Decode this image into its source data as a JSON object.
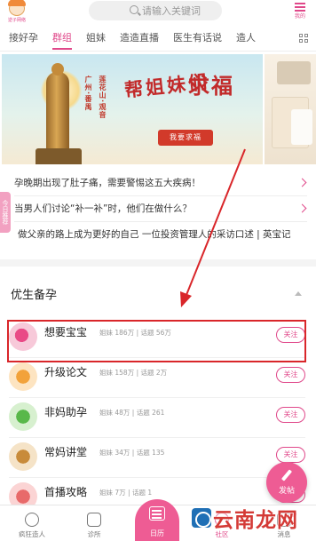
{
  "header": {
    "logo_caption": "逆子网络",
    "search_placeholder": "请输入关键词",
    "menu_label": "我的"
  },
  "tabs": [
    "接好孕",
    "群组",
    "姐妹",
    "造造直播",
    "医生有话说",
    "造人"
  ],
  "banner": {
    "vertical_text_1": "广州·番禺",
    "vertical_text_2": "莲花山·观音",
    "title_1": "帮姐妹们",
    "title_2": "求福",
    "button": "我要求福"
  },
  "side_tag": "今日推荐",
  "news": [
    "孕晚期出现了肚子痛，需要警惕这五大疾病！",
    "当男人们讨论“补一补”时，他们在做什么？",
    "做父亲的路上成为更好的自己 一位投资管理人的采访口述 | 英宝记"
  ],
  "section": {
    "title": "优生备孕"
  },
  "groups": [
    {
      "name": "想要宝宝",
      "stats": "姐妹 186万 | 话题 56万",
      "follow": "关注",
      "avatar_color": "#e94a86"
    },
    {
      "name": "升级论文",
      "stats": "姐妹 158万 | 话题 2万",
      "follow": "关注",
      "avatar_color": "#f2a23a"
    },
    {
      "name": "非妈助孕",
      "stats": "姐妹 48万 | 话题 261",
      "follow": "关注",
      "avatar_color": "#59b84a"
    },
    {
      "name": "常妈讲堂",
      "stats": "姐妹 34万 | 话题 135",
      "follow": "关注",
      "avatar_color": "#c88b3a"
    },
    {
      "name": "首播攻略",
      "stats": "姐妹 7万 | 话题 1",
      "follow": "关注",
      "avatar_color": "#e86a6a"
    }
  ],
  "fab": {
    "label": "发帖"
  },
  "bottom_nav": {
    "items": [
      {
        "label": "疯狂造人",
        "icon": "compass-icon"
      },
      {
        "label": "诊所",
        "icon": "clinic-icon"
      },
      {
        "label": "日历",
        "icon": "calendar-icon"
      },
      {
        "label": "社区",
        "icon": "community-icon"
      },
      {
        "label": "消息",
        "icon": "message-icon"
      }
    ]
  },
  "watermark": "云南龙网",
  "colors": {
    "accent": "#e0488a",
    "highlight": "#d9262a"
  }
}
